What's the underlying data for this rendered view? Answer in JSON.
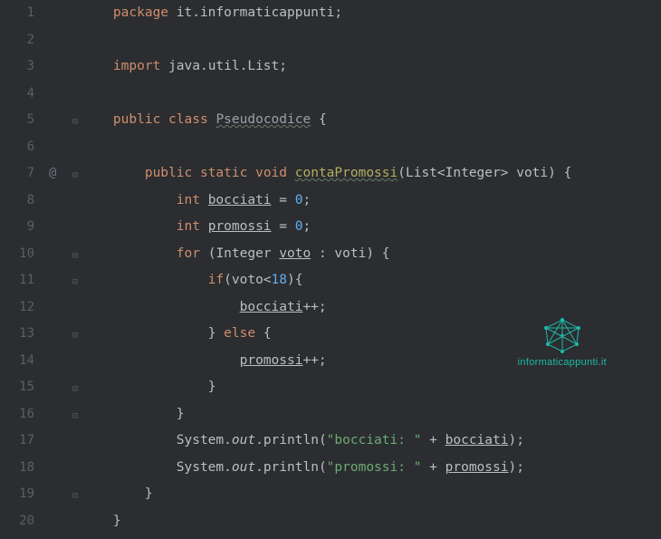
{
  "watermark": {
    "text": "informaticappunti.it"
  },
  "lines": [
    {
      "num": "1",
      "icons": {},
      "tokens": [
        [
          "",
          "    "
        ],
        [
          "kw",
          "package"
        ],
        [
          "",
          " "
        ],
        [
          "pkg",
          "it.informaticappunti"
        ],
        [
          "punct",
          ";"
        ]
      ]
    },
    {
      "num": "2",
      "icons": {},
      "tokens": []
    },
    {
      "num": "3",
      "icons": {},
      "tokens": [
        [
          "",
          "    "
        ],
        [
          "kw",
          "import"
        ],
        [
          "",
          " "
        ],
        [
          "pkg",
          "java.util.List"
        ],
        [
          "punct",
          ";"
        ]
      ]
    },
    {
      "num": "4",
      "icons": {},
      "tokens": []
    },
    {
      "num": "5",
      "icons": {
        "fold": "⊟"
      },
      "tokens": [
        [
          "",
          "    "
        ],
        [
          "kw",
          "public"
        ],
        [
          "",
          " "
        ],
        [
          "kw",
          "class"
        ],
        [
          "",
          " "
        ],
        [
          "cls",
          "Pseudocodice"
        ],
        [
          "",
          " "
        ],
        [
          "punct",
          "{"
        ]
      ]
    },
    {
      "num": "6",
      "icons": {},
      "tokens": []
    },
    {
      "num": "7",
      "icons": {
        "at": "@",
        "fold": "⊟"
      },
      "tokens": [
        [
          "",
          "        "
        ],
        [
          "kw",
          "public"
        ],
        [
          "",
          " "
        ],
        [
          "kw",
          "static"
        ],
        [
          "",
          " "
        ],
        [
          "kw",
          "void"
        ],
        [
          "",
          " "
        ],
        [
          "method",
          "contaPromossi"
        ],
        [
          "punct",
          "("
        ],
        [
          "type",
          "List"
        ],
        [
          "punct",
          "<"
        ],
        [
          "type",
          "Integer"
        ],
        [
          "punct",
          ">"
        ],
        [
          "",
          " voti"
        ],
        [
          "punct",
          ")"
        ],
        [
          "",
          " "
        ],
        [
          "punct",
          "{"
        ]
      ]
    },
    {
      "num": "8",
      "icons": {},
      "tokens": [
        [
          "",
          "            "
        ],
        [
          "kw",
          "int"
        ],
        [
          "",
          " "
        ],
        [
          "underl",
          "bocciati"
        ],
        [
          "",
          " "
        ],
        [
          "op",
          "="
        ],
        [
          "",
          " "
        ],
        [
          "num",
          "0"
        ],
        [
          "punct",
          ";"
        ]
      ]
    },
    {
      "num": "9",
      "icons": {},
      "tokens": [
        [
          "",
          "            "
        ],
        [
          "kw",
          "int"
        ],
        [
          "",
          " "
        ],
        [
          "underl",
          "promossi"
        ],
        [
          "",
          " "
        ],
        [
          "op",
          "="
        ],
        [
          "",
          " "
        ],
        [
          "num",
          "0"
        ],
        [
          "punct",
          ";"
        ]
      ]
    },
    {
      "num": "10",
      "icons": {
        "fold": "⊟"
      },
      "tokens": [
        [
          "",
          "            "
        ],
        [
          "kw",
          "for"
        ],
        [
          "",
          " "
        ],
        [
          "punct",
          "("
        ],
        [
          "type",
          "Integer"
        ],
        [
          "",
          " "
        ],
        [
          "underl",
          "voto"
        ],
        [
          "",
          " "
        ],
        [
          "op",
          ":"
        ],
        [
          "",
          " voti"
        ],
        [
          "punct",
          ")"
        ],
        [
          "",
          " "
        ],
        [
          "punct",
          "{"
        ]
      ]
    },
    {
      "num": "11",
      "icons": {
        "fold": "⊟"
      },
      "tokens": [
        [
          "",
          "                "
        ],
        [
          "kw",
          "if"
        ],
        [
          "punct",
          "("
        ],
        [
          "",
          "voto"
        ],
        [
          "op",
          "<"
        ],
        [
          "num",
          "18"
        ],
        [
          "punct",
          ")"
        ],
        [
          "punct",
          "{"
        ]
      ]
    },
    {
      "num": "12",
      "icons": {},
      "tokens": [
        [
          "",
          "                    "
        ],
        [
          "underl",
          "bocciati"
        ],
        [
          "op",
          "++"
        ],
        [
          "punct",
          ";"
        ]
      ]
    },
    {
      "num": "13",
      "icons": {
        "fold": "⊟"
      },
      "tokens": [
        [
          "",
          "                "
        ],
        [
          "punct",
          "}"
        ],
        [
          "",
          " "
        ],
        [
          "kw",
          "else"
        ],
        [
          "",
          " "
        ],
        [
          "punct",
          "{"
        ]
      ]
    },
    {
      "num": "14",
      "icons": {},
      "tokens": [
        [
          "",
          "                    "
        ],
        [
          "underl",
          "promossi"
        ],
        [
          "op",
          "++"
        ],
        [
          "punct",
          ";"
        ]
      ]
    },
    {
      "num": "15",
      "icons": {
        "fold": "⊡"
      },
      "tokens": [
        [
          "",
          "                "
        ],
        [
          "punct",
          "}"
        ]
      ]
    },
    {
      "num": "16",
      "icons": {
        "fold": "⊡"
      },
      "tokens": [
        [
          "",
          "            "
        ],
        [
          "punct",
          "}"
        ]
      ]
    },
    {
      "num": "17",
      "icons": {},
      "tokens": [
        [
          "",
          "            "
        ],
        [
          "type",
          "System"
        ],
        [
          "punct",
          "."
        ],
        [
          "field",
          "out"
        ],
        [
          "punct",
          "."
        ],
        [
          "",
          "println"
        ],
        [
          "punct",
          "("
        ],
        [
          "str",
          "\"bocciati: \""
        ],
        [
          "",
          " "
        ],
        [
          "op",
          "+"
        ],
        [
          "",
          " "
        ],
        [
          "underl",
          "bocciati"
        ],
        [
          "punct",
          ")"
        ],
        [
          "punct",
          ";"
        ]
      ]
    },
    {
      "num": "18",
      "icons": {},
      "tokens": [
        [
          "",
          "            "
        ],
        [
          "type",
          "System"
        ],
        [
          "punct",
          "."
        ],
        [
          "field",
          "out"
        ],
        [
          "punct",
          "."
        ],
        [
          "",
          "println"
        ],
        [
          "punct",
          "("
        ],
        [
          "str",
          "\"promossi: \""
        ],
        [
          "",
          " "
        ],
        [
          "op",
          "+"
        ],
        [
          "",
          " "
        ],
        [
          "underl",
          "promossi"
        ],
        [
          "punct",
          ")"
        ],
        [
          "punct",
          ";"
        ]
      ]
    },
    {
      "num": "19",
      "icons": {
        "fold": "⊡"
      },
      "tokens": [
        [
          "",
          "        "
        ],
        [
          "punct",
          "}"
        ]
      ]
    },
    {
      "num": "20",
      "icons": {},
      "tokens": [
        [
          "",
          "    "
        ],
        [
          "punct",
          "}"
        ]
      ]
    }
  ]
}
